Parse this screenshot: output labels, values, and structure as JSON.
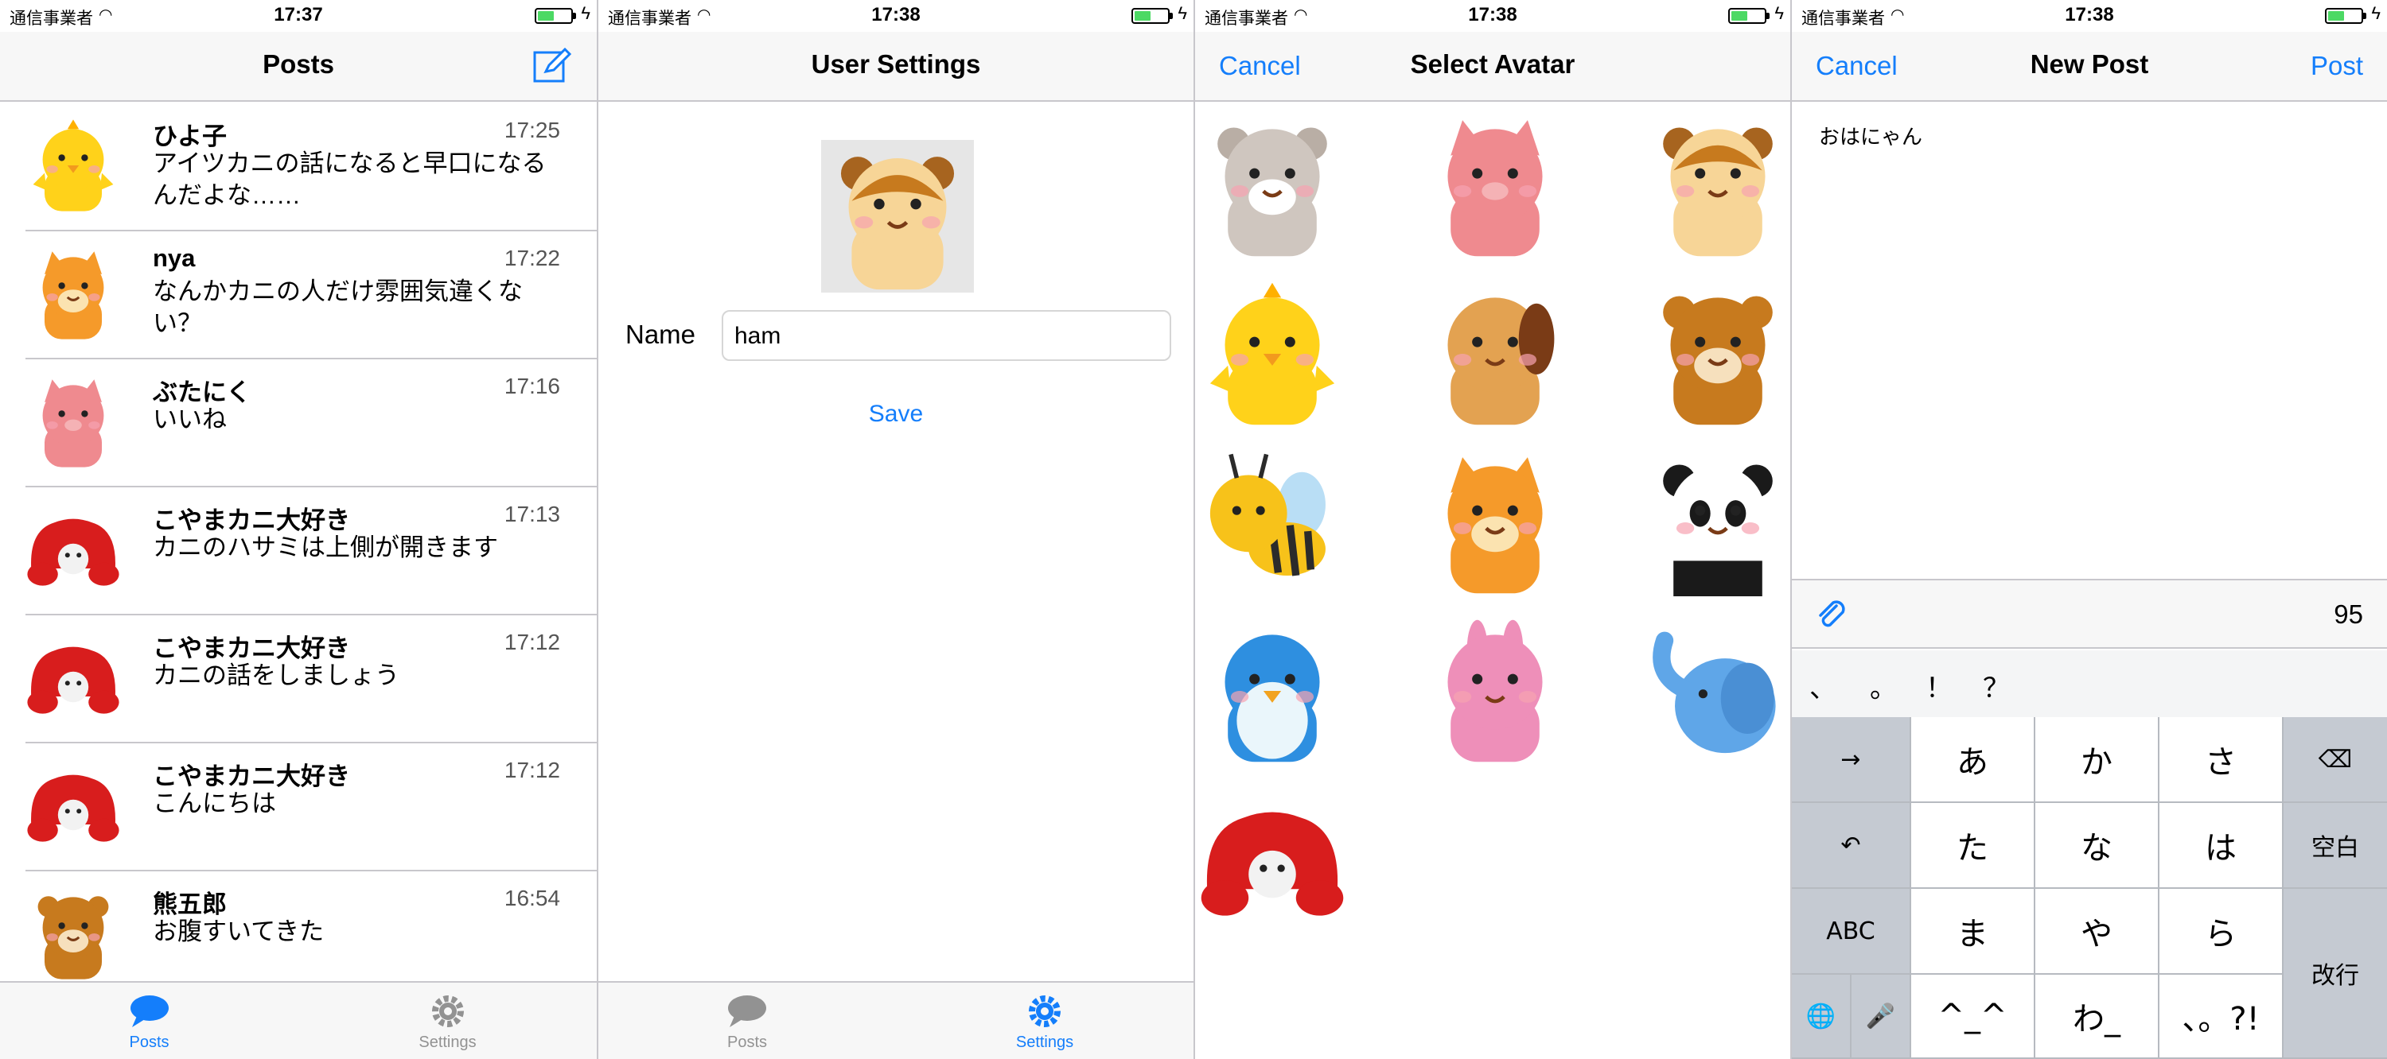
{
  "status": {
    "carrier": "通信事業者",
    "screens_time": [
      "17:37",
      "17:38",
      "17:38",
      "17:38"
    ]
  },
  "posts_screen": {
    "title": "Posts",
    "posts": [
      {
        "name": "ひよ子",
        "time": "17:25",
        "body": "アイツカニの話になると早口になるんだよな……",
        "avatar": "chick"
      },
      {
        "name": "nya",
        "time": "17:22",
        "body": "なんかカニの人だけ雰囲気違くない？",
        "avatar": "cat"
      },
      {
        "name": "ぶたにく",
        "time": "17:16",
        "body": "いいね",
        "avatar": "pig"
      },
      {
        "name": "こやまカニ大好き",
        "time": "17:13",
        "body": "カニのハサミは上側が開きます",
        "avatar": "crab"
      },
      {
        "name": "こやまカニ大好き",
        "time": "17:12",
        "body": "カニの話をしましょう",
        "avatar": "crab"
      },
      {
        "name": "こやまカニ大好き",
        "time": "17:12",
        "body": "こんにちは",
        "avatar": "crab"
      },
      {
        "name": "熊五郎",
        "time": "16:54",
        "body": "お腹すいてきた",
        "avatar": "bear"
      }
    ]
  },
  "tabs": {
    "posts": "Posts",
    "settings": "Settings"
  },
  "settings_screen": {
    "title": "User Settings",
    "name_label": "Name",
    "name_value": "ham",
    "save": "Save",
    "avatar": "hamster"
  },
  "avatar_screen": {
    "title": "Select Avatar",
    "cancel": "Cancel",
    "avatars": [
      "alpaca",
      "pig",
      "hamster",
      "chick",
      "dog",
      "bear",
      "bee",
      "cat",
      "panda",
      "penguin",
      "rabbit",
      "elephant",
      "crab"
    ]
  },
  "newpost_screen": {
    "title": "New Post",
    "cancel": "Cancel",
    "post": "Post",
    "text": "おはにゃん",
    "remaining": "95",
    "candidates": [
      "、",
      "。",
      "！",
      "？"
    ],
    "keys": {
      "row1": [
        "→",
        "あ",
        "か",
        "さ",
        "⌫"
      ],
      "row2": [
        "↶",
        "た",
        "な",
        "は",
        "空白"
      ],
      "row3": [
        "ABC",
        "ま",
        "や",
        "ら",
        "改行"
      ],
      "row4": [
        "🌐",
        "🎤",
        "^_^",
        "わ_",
        "、。?!"
      ]
    }
  },
  "colors": {
    "accent": "#147efb",
    "bar": "#f7f7f7",
    "separator": "#c8c7cc",
    "battery": "#4cd964"
  }
}
